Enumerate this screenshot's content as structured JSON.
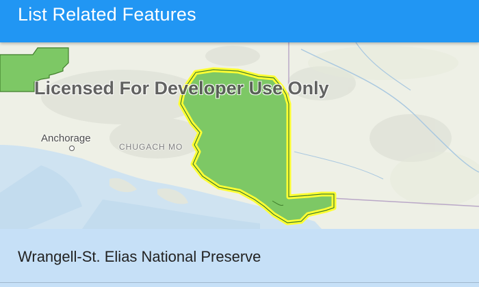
{
  "app_bar": {
    "title": "List Related Features"
  },
  "map": {
    "watermark": "Licensed For Developer Use Only",
    "labels": {
      "anchorage": "Anchorage",
      "chugach": "CHUGACH MO"
    },
    "highlight_color": "#ffff33",
    "feature_fill": "#7dc865"
  },
  "results": {
    "items": [
      {
        "label": "Wrangell-St. Elias National Preserve"
      }
    ]
  }
}
